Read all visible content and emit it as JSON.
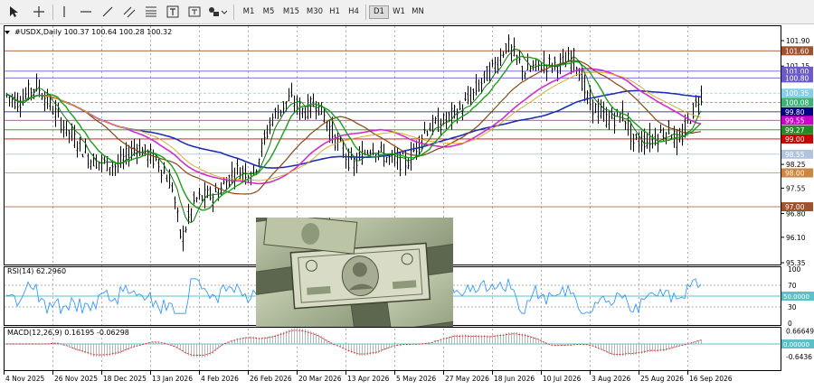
{
  "toolbar": {
    "timeframes": [
      "M1",
      "M5",
      "M15",
      "M30",
      "H1",
      "H4",
      "D1",
      "W1",
      "MN"
    ],
    "active_timeframe": "D1",
    "tools": [
      "cursor-icon",
      "crosshair-icon",
      "vertical-line-icon",
      "horizontal-line-icon",
      "trend-line-icon",
      "equidistant-channel-icon",
      "fibonacci-icon",
      "text-icon",
      "shapes-icon"
    ]
  },
  "chart": {
    "header": "#USDX,Daily  100.37 100.64 100.28 100.32",
    "price_ticks": [
      "101.90",
      "101.15",
      "100.35",
      "99.65",
      "98.95",
      "98.25",
      "97.55",
      "96.80",
      "96.10",
      "95.35"
    ],
    "price_levels": [
      {
        "label": "101.60",
        "color": "#a0522d"
      },
      {
        "label": "101.00",
        "color": "#6a5acd"
      },
      {
        "label": "100.80",
        "color": "#6a5acd"
      },
      {
        "label": "100.35",
        "color": "#87ceeb"
      },
      {
        "label": "100.08",
        "color": "#3cb371"
      },
      {
        "label": "99.80",
        "color": "#00008b"
      },
      {
        "label": "99.55",
        "color": "#cc00cc"
      },
      {
        "label": "99.27",
        "color": "#228b22"
      },
      {
        "label": "99.00",
        "color": "#cc0000"
      },
      {
        "label": "98.55",
        "color": "#b0c4de"
      },
      {
        "label": "98.00",
        "color": "#cd853f"
      },
      {
        "label": "97.00",
        "color": "#a0522d"
      }
    ],
    "date_labels": [
      "4 Nov 2025",
      "26 Nov 2025",
      "18 Dec 2025",
      "13 Jan 2026",
      "4 Feb 2026",
      "26 Feb 2026",
      "20 Mar 2026",
      "13 Apr 2026",
      "5 May 2026",
      "27 May 2026",
      "18 Jun 2026",
      "10 Jul 2026",
      "3 Aug 2026",
      "25 Aug 2026",
      "16 Sep 2026"
    ]
  },
  "rsi": {
    "header": "RSI(14) 62.2960",
    "ticks": [
      "100",
      "70",
      "50.0000",
      "30",
      "0"
    ]
  },
  "macd": {
    "header": "MACD(12,26,9) 0.16195 -0.06298",
    "ticks": [
      "0.66649",
      "0.00000",
      "-0.6436"
    ]
  },
  "colors": {
    "candle": "#000000",
    "ma_blue": "#1f2fb3",
    "ma_magenta": "#d02fd0",
    "ma_brown": "#8b4513",
    "ma_green": "#1aa01a",
    "ma_gold": "#daa520",
    "level_line": "#999999"
  },
  "image_caption": "",
  "icons": {
    "chart_menu": "triangle-down-icon"
  }
}
